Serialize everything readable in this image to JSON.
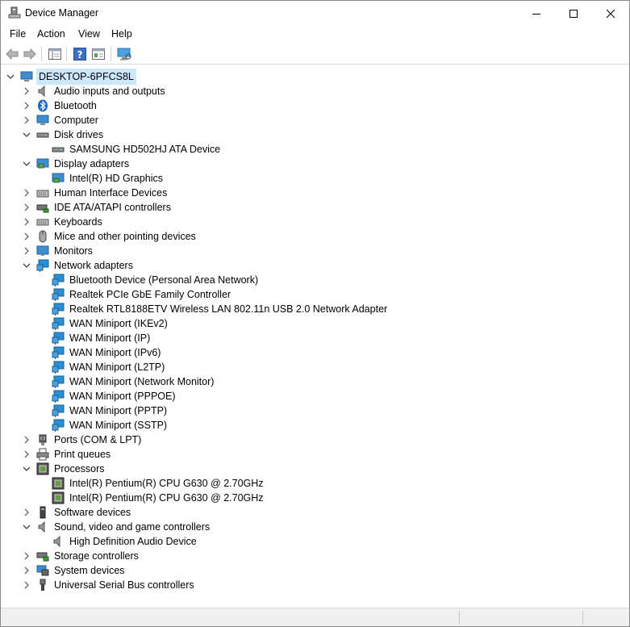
{
  "window": {
    "title": "Device Manager"
  },
  "menu": {
    "file": "File",
    "action": "Action",
    "view": "View",
    "help": "Help"
  },
  "tree": {
    "root": "DESKTOP-6PFCS8L",
    "categories": {
      "audio": "Audio inputs and outputs",
      "bluetooth": "Bluetooth",
      "computer": "Computer",
      "disk": "Disk drives",
      "display": "Display adapters",
      "hid": "Human Interface Devices",
      "ide": "IDE ATA/ATAPI controllers",
      "keyboards": "Keyboards",
      "mice": "Mice and other pointing devices",
      "monitors": "Monitors",
      "network": "Network adapters",
      "ports": "Ports (COM & LPT)",
      "print": "Print queues",
      "processors": "Processors",
      "software": "Software devices",
      "sound": "Sound, video and game controllers",
      "storage": "Storage controllers",
      "system": "System devices",
      "usb": "Universal Serial Bus controllers"
    },
    "devices": {
      "disk0": "SAMSUNG HD502HJ ATA Device",
      "display0": "Intel(R) HD Graphics",
      "net0": "Bluetooth Device (Personal Area Network)",
      "net1": "Realtek PCIe GbE Family Controller",
      "net2": "Realtek RTL8188ETV Wireless LAN 802.11n USB 2.0 Network Adapter",
      "net3": "WAN Miniport (IKEv2)",
      "net4": "WAN Miniport (IP)",
      "net5": "WAN Miniport (IPv6)",
      "net6": "WAN Miniport (L2TP)",
      "net7": "WAN Miniport (Network Monitor)",
      "net8": "WAN Miniport (PPPOE)",
      "net9": "WAN Miniport (PPTP)",
      "net10": "WAN Miniport (SSTP)",
      "cpu0": "Intel(R) Pentium(R) CPU G630 @ 2.70GHz",
      "cpu1": "Intel(R) Pentium(R) CPU G630 @ 2.70GHz",
      "sound0": "High Definition Audio Device"
    }
  },
  "colors": {
    "selection": "#cce8ff",
    "statusbar": "#f0f0f0",
    "network_icon": "#2b8fd6"
  }
}
